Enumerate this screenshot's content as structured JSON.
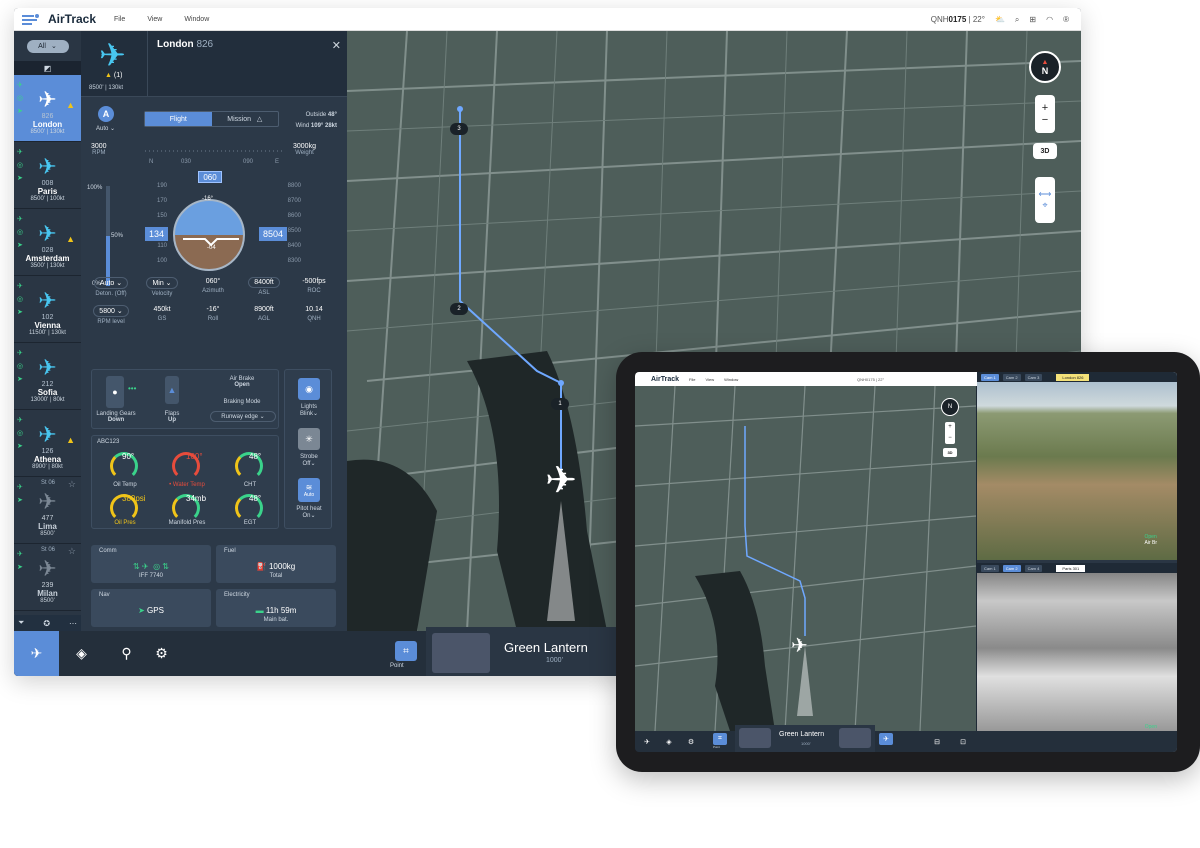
{
  "app": {
    "title": "AirTrack",
    "menus": [
      "File",
      "View",
      "Window"
    ]
  },
  "status_bar": {
    "qnh_label": "QNH",
    "qnh_value": "0175",
    "temp": "22°"
  },
  "aircraft_filter": "All",
  "aircraft_list": [
    {
      "num": "826",
      "name": "London",
      "meta": "8500' | 130kt",
      "active": true,
      "warn": true
    },
    {
      "num": "008",
      "name": "Paris",
      "meta": "8500' | 100kt",
      "active": false,
      "warn": false
    },
    {
      "num": "028",
      "name": "Amsterdam",
      "meta": "3500' | 130kt",
      "active": false,
      "warn": true
    },
    {
      "num": "102",
      "name": "Vienna",
      "meta": "11500' | 130kt",
      "active": false,
      "warn": false
    },
    {
      "num": "212",
      "name": "Sofia",
      "meta": "13000' | 80kt",
      "active": false,
      "warn": false
    },
    {
      "num": "126",
      "name": "Athena",
      "meta": "8900' | 80kt",
      "active": false,
      "warn": true
    },
    {
      "num": "477",
      "name": "Lima",
      "meta": "8500'",
      "sub": "St 06",
      "gray": true
    },
    {
      "num": "239",
      "name": "Milan",
      "meta": "8500'",
      "sub": "St 06",
      "gray": true
    }
  ],
  "detail": {
    "title": "London",
    "title_num": "826",
    "alert_count": "(1)",
    "altspd": "8500' | 130kt",
    "auto_badge": "A",
    "auto_label": "Auto",
    "tabs": {
      "flight": "Flight",
      "mission": "Mission"
    },
    "outside_label": "Outside",
    "outside_value": "48°",
    "wind_label": "Wind",
    "wind_value": "109° 28kt",
    "rpm_value": "3000",
    "rpm_label": "RPM",
    "weight_value": "3000kg",
    "weight_label": "Weight",
    "heading_ticks": [
      "N",
      "030",
      "060",
      "090",
      "E"
    ],
    "heading": "060",
    "speed_scale": [
      "190",
      "170",
      "150",
      "130",
      "110",
      "100"
    ],
    "alt_scale": [
      "8800",
      "8700",
      "8600",
      "8500",
      "8400",
      "8300"
    ],
    "pct_top": "100%",
    "pct_mid": "50%",
    "pct_bot": "0%",
    "speed_box": "134",
    "alt_box": "8504",
    "pitch": "-16°",
    "roll_small": "-04",
    "readouts_row1": [
      {
        "value": "Auto",
        "label": "Deton. (Off)"
      },
      {
        "value": "Min",
        "label": "Velocity"
      },
      {
        "value": "060°",
        "label": "Azimuth"
      },
      {
        "value": "8400ft",
        "label": "ASL"
      },
      {
        "value": "-500fps",
        "label": "ROC"
      }
    ],
    "readouts_row2": [
      {
        "value": "5800",
        "label": "RPM level"
      },
      {
        "value": "450kt",
        "label": "GS"
      },
      {
        "value": "-16°",
        "label": "Roll"
      },
      {
        "value": "8900ft",
        "label": "AGL"
      },
      {
        "value": "10.14",
        "label": "QNH"
      }
    ],
    "landing_gear_label": "Landing Gears",
    "landing_gear_value": "Down",
    "flaps_label": "Flaps",
    "flaps_value": "Up",
    "air_brake_label": "Air Brake",
    "air_brake_value": "Open",
    "braking_mode_label": "Braking Mode",
    "braking_mode_value": "Runway edge",
    "lights_label": "Lights",
    "lights_value": "Blink",
    "strobe_label": "Strobe",
    "strobe_value": "Off",
    "pitot_label": "Pitot heat",
    "pitot_value": "On",
    "pitot_badge": "Auto",
    "engine_group": "ABC123",
    "gauges": [
      {
        "value": "90°",
        "label": "Oil Temp",
        "state": "normal"
      },
      {
        "value": "100°",
        "label": "Water Temp",
        "state": "red"
      },
      {
        "value": "48°",
        "label": "CHT",
        "state": "normal"
      },
      {
        "value": "380psi",
        "label": "Oil Pres",
        "state": "yel"
      },
      {
        "value": "34mb",
        "label": "Manifold Pres",
        "state": "normal"
      },
      {
        "value": "48°",
        "label": "EGT",
        "state": "normal"
      }
    ],
    "comm_title": "Comm",
    "comm_iff": "IFF 7740",
    "fuel_title": "Fuel",
    "fuel_value": "1000kg",
    "fuel_sub": "Total",
    "nav_title": "Nav",
    "nav_value": "GPS",
    "elec_title": "Electricity",
    "elec_value": "11h 59m",
    "elec_sub": "Main bat."
  },
  "map": {
    "waypoints": [
      "3",
      "2",
      "1"
    ],
    "compass": "N",
    "zoom_in": "+",
    "zoom_out": "−",
    "view_3d": "3D"
  },
  "bottom": {
    "point_label": "Point",
    "camera_name": "Green Lantern",
    "camera_alt": "1000'"
  },
  "ipad": {
    "title": "AirTrack",
    "menus": [
      "File",
      "View",
      "Window"
    ],
    "qnh": "QNH0175 | 22°",
    "cam_top_name": "London 826",
    "cam_bot_name": "Paris 301",
    "cam_tabs": [
      "Cam 1",
      "Cam 2",
      "Cam 3",
      "Cam 4"
    ],
    "air_br": "Air Br",
    "open": "Open",
    "camera_name": "Green Lantern",
    "camera_alt": "1000'",
    "point_label": "Point",
    "compass": "N",
    "view_3d": "3D"
  }
}
